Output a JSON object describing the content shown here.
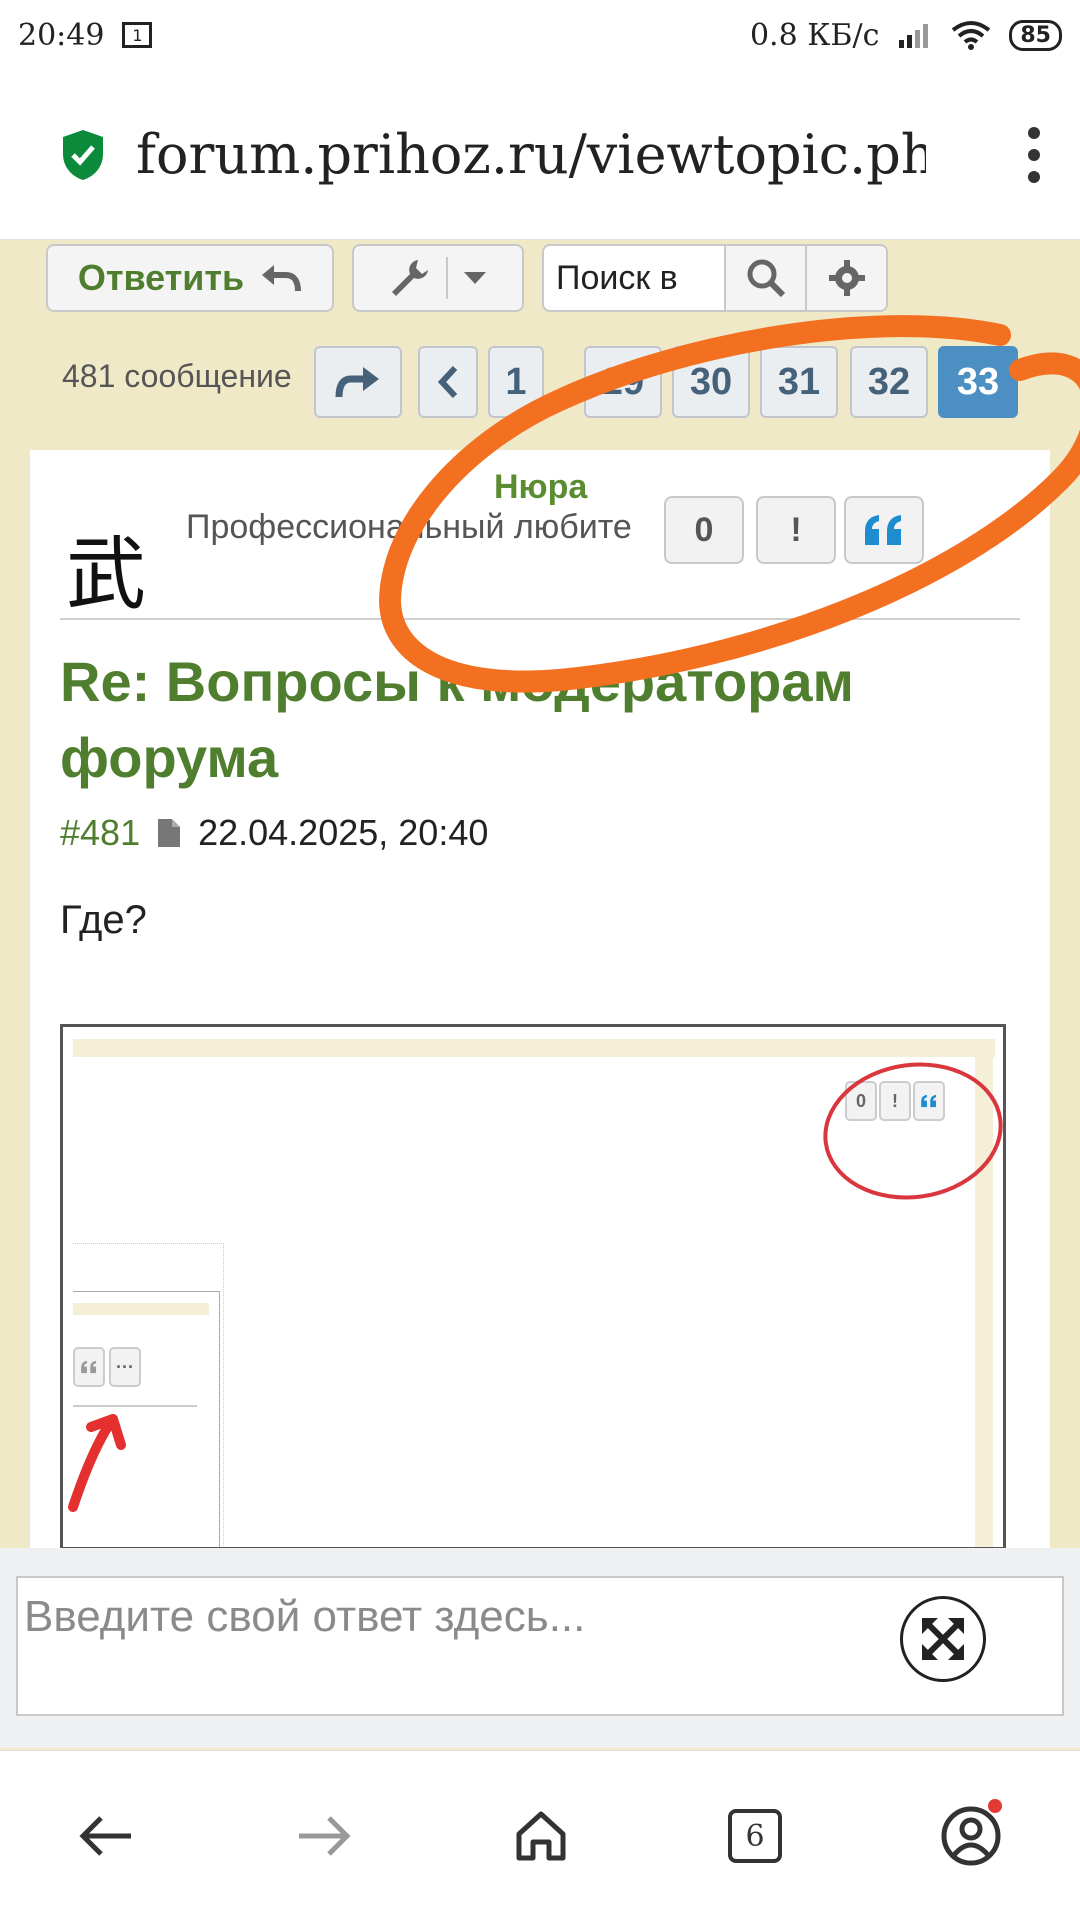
{
  "status_bar": {
    "time": "20:49",
    "sim": "1",
    "speed": "0.8 КБ/с",
    "battery": "85"
  },
  "browser": {
    "url": "forum.prihoz.ru/viewtopic.ph",
    "tab_count": "6"
  },
  "toolbar": {
    "reply_label": "Ответить",
    "search_placeholder": "Поиск в"
  },
  "pagination": {
    "post_count": "481 сообщение",
    "pages": [
      "1",
      "29",
      "30",
      "31",
      "32",
      "33"
    ],
    "ellipsis": "…",
    "current": "33"
  },
  "post": {
    "avatar_glyph": "武",
    "author": "Нюра",
    "rank": "Профессиональный любите",
    "likes": "0",
    "report": "!",
    "title": "Re: Вопросы к модераторам форума",
    "number": "#481",
    "date": "22.04.2025, 20:40",
    "body": "Где?"
  },
  "embedded_image": {
    "mini_buttons": [
      "0",
      "!"
    ],
    "mini_more": "···"
  },
  "composer": {
    "placeholder": "Введите свой ответ здесь..."
  },
  "colors": {
    "accent_green": "#4f7f2e",
    "active_page": "#4c8fc3",
    "annotation_orange": "#f37021",
    "annotation_red": "#d9363e",
    "page_bg": "#f0e9c8"
  }
}
